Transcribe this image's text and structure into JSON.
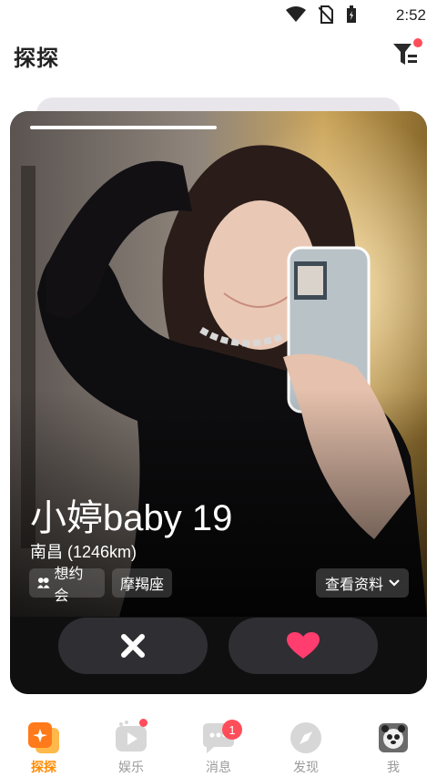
{
  "status_bar": {
    "time": "2:52",
    "icons": [
      "wifi-icon",
      "no-sim-icon",
      "battery-icon"
    ]
  },
  "header": {
    "title": "探探",
    "filter_icon": "filter-icon"
  },
  "card": {
    "name_age": "小婷baby 19",
    "location": "南昌 (1246km)",
    "tags": [
      "想约会",
      "摩羯座"
    ],
    "view_profile": "查看资料",
    "actions": {
      "dislike_icon": "close-icon",
      "like_icon": "heart-icon"
    }
  },
  "bottom_nav": {
    "items": [
      {
        "label": "探探",
        "icon": "discover-cards-icon",
        "active": true
      },
      {
        "label": "娱乐",
        "icon": "play-icon",
        "dot": true
      },
      {
        "label": "消息",
        "icon": "chat-icon",
        "badge": "1"
      },
      {
        "label": "发现",
        "icon": "compass-icon"
      },
      {
        "label": "我",
        "icon": "avatar-icon"
      }
    ]
  },
  "colors": {
    "accent": "#ff8a00",
    "like": "#ff3d6e",
    "badge": "#ff4d5a"
  }
}
